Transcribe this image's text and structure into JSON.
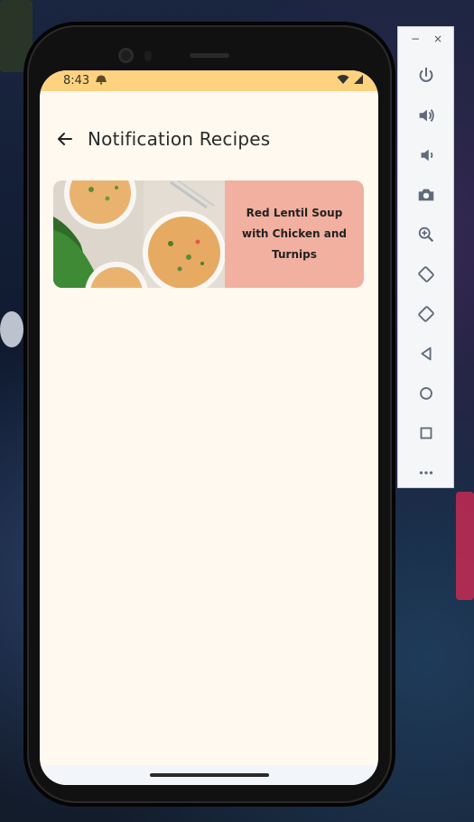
{
  "status_bar": {
    "time": "8:43"
  },
  "app_bar": {
    "title": "Notification Recipes"
  },
  "recipe_card": {
    "title": "Red Lentil Soup with Chicken and Turnips"
  },
  "side_panel": {
    "window_min": "−",
    "window_close": "×",
    "icons": [
      "power-icon",
      "volume-up-icon",
      "volume-down-icon",
      "camera-icon",
      "zoom-icon",
      "rotate-left-icon",
      "rotate-right-icon",
      "back-icon",
      "home-icon",
      "overview-icon",
      "more-icon"
    ]
  },
  "colors": {
    "status_bar": "#ffd27f",
    "screen_bg": "#fff9f0",
    "card_bg": "#f2b0a0"
  }
}
